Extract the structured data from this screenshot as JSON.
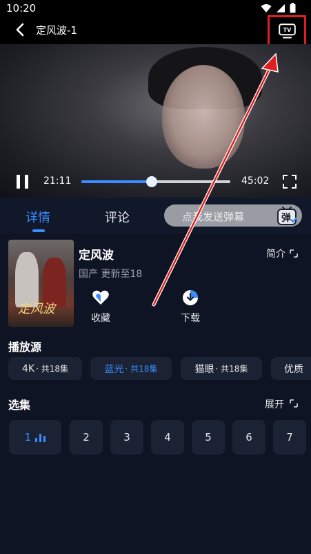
{
  "status_bar": {
    "time": "10:20"
  },
  "header": {
    "title": "定风波-1",
    "tv_label": "TV"
  },
  "player": {
    "current_time": "21:11",
    "duration": "45:02",
    "progress": 0.47
  },
  "tabs": [
    {
      "label": "详情",
      "active": true
    },
    {
      "label": "评论",
      "active": false
    }
  ],
  "danmu": {
    "placeholder": "点我发送弹幕",
    "icon_label": "弹"
  },
  "show": {
    "title": "定风波",
    "meta": "国产 更新至18",
    "poster_text": "定风波",
    "intro_label": "简介"
  },
  "actions": [
    {
      "label": "收藏",
      "icon": "heart-icon"
    },
    {
      "label": "下载",
      "icon": "download-icon"
    }
  ],
  "source": {
    "title": "播放源",
    "chips": [
      {
        "name": "4K",
        "count": " · 共18集",
        "active": false
      },
      {
        "name": "蓝光",
        "count": " · 共18集",
        "active": true
      },
      {
        "name": "猫眼",
        "count": " · 共18集",
        "active": false
      },
      {
        "name": "优质",
        "count": "",
        "active": false
      }
    ]
  },
  "episodes": {
    "title": "选集",
    "expand_label": "展开",
    "items": [
      "1",
      "2",
      "3",
      "4",
      "5",
      "6",
      "7"
    ]
  },
  "colors": {
    "accent": "#3a8cff",
    "background": "#0f1424",
    "annotation": "#e02020"
  }
}
